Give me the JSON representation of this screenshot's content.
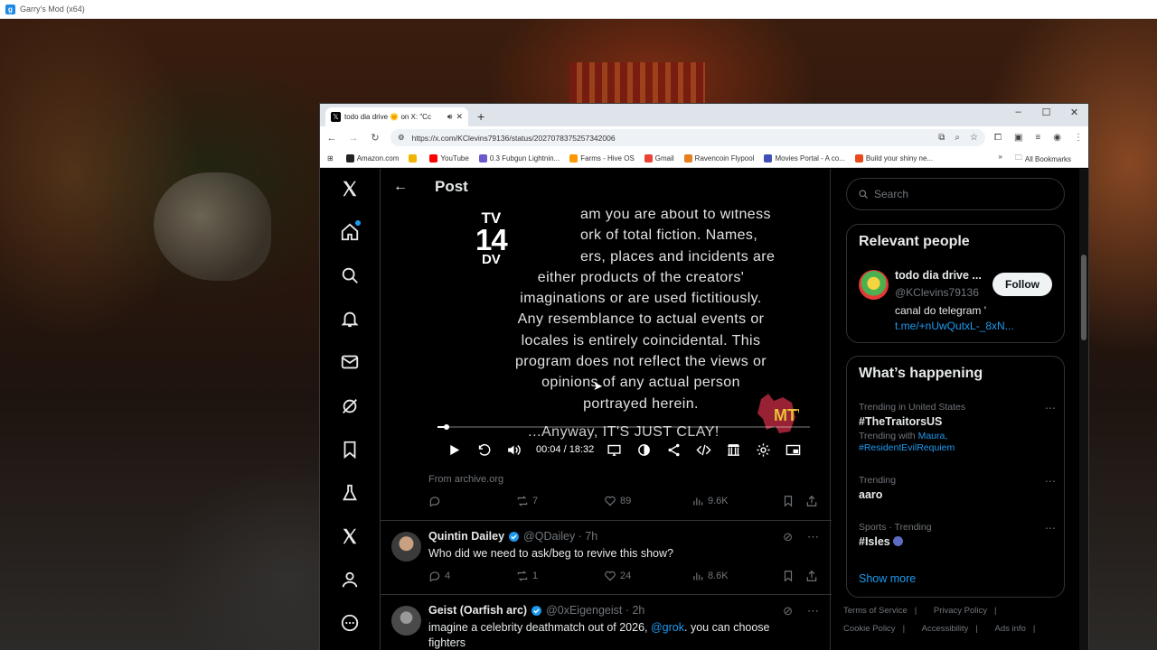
{
  "outer_window": {
    "title": "Garry's Mod (x64)"
  },
  "browser": {
    "tab": {
      "title": "todo dia drive 🌞 on X: \"Cc",
      "favicon": "x-logo-icon"
    },
    "new_tab": "+",
    "window_controls": [
      "–",
      "☐",
      "✕"
    ],
    "url": "https://x.com/KClevins79136/status/2027078375257342006",
    "bookmarks": [
      {
        "label": "Amazon.com",
        "color": "#222222"
      },
      {
        "label": "",
        "color": "#f0b400"
      },
      {
        "label": "YouTube",
        "color": "#ff0000"
      },
      {
        "label": "0.3 Fubgun Lightnin...",
        "color": "#6a5acd"
      },
      {
        "label": "Farms - Hive OS",
        "color": "#ff9800"
      },
      {
        "label": "Gmail",
        "color": "#ea4335"
      },
      {
        "label": "Ravencoin Flypool",
        "color": "#e67e22"
      },
      {
        "label": "Movies Portal - A co...",
        "color": "#3f51b5"
      },
      {
        "label": "Build your shiny ne...",
        "color": "#e64a19"
      }
    ],
    "bookmarks_overflow": "»",
    "all_bookmarks": "All Bookmarks"
  },
  "x": {
    "header": {
      "title": "Post",
      "back": "←"
    },
    "video": {
      "badge_top": "TV",
      "badge_mid": "14",
      "badge_bottom": "DV",
      "text_lines": [
        "am you are about to witness",
        "ork of total fiction.  Names,",
        "ers, places and incidents are",
        "either products of the creators'",
        "imaginations or are used fictitiously.",
        "Any resemblance to actual events or",
        "locales is entirely coincidental.  This",
        "program does not reflect the views or",
        "opinions of any actual person",
        "portrayed herein."
      ],
      "punchline": "...Anyway, IT'S JUST CLAY!",
      "logo_text": "MTV 2",
      "progress": 0.004,
      "current_time": "00:04",
      "time_separator": "/",
      "duration": "18:32"
    },
    "source": "From archive.org",
    "main_stats": {
      "retweets": "7",
      "likes": "89",
      "views": "9.6K"
    },
    "replies": [
      {
        "name": "Quintin Dailey",
        "handle": "@QDailey · 7h",
        "text": "Who did we need to ask/beg to revive this show?",
        "replies": "4",
        "retweets": "1",
        "likes": "24",
        "views": "8.6K"
      },
      {
        "name": "Geist (Oarfish arc)",
        "handle": "@0xEigengeist · 2h",
        "text_before": "imagine a celebrity deathmatch out of 2026, ",
        "mention": "@grok",
        "text_after": ". you can choose fighters"
      }
    ],
    "search_placeholder": "Search",
    "relevant_people": {
      "title": "Relevant people",
      "name": "todo dia drive ...",
      "handle": "@KClevins79136",
      "follow": "Follow",
      "bio": "canal do telegram '",
      "link": "t.me/+nUwQutxL-_8xN..."
    },
    "whats_happening": {
      "title": "What’s happening",
      "trends": [
        {
          "meta": "Trending in United States",
          "name": "#TheTraitorsUS",
          "with_label": "Trending with",
          "with_1": "Maura,",
          "with_2": "#ResidentEvilRequiem"
        },
        {
          "meta": "Trending",
          "name": "aaro"
        },
        {
          "meta": "Sports · Trending",
          "name": "#Isles"
        }
      ],
      "show_more": "Show more"
    },
    "footer": {
      "terms": "Terms of Service",
      "privacy": "Privacy Policy",
      "cookie": "Cookie Policy",
      "accessibility": "Accessibility",
      "ads": "Ads info",
      "sep": "|"
    }
  }
}
